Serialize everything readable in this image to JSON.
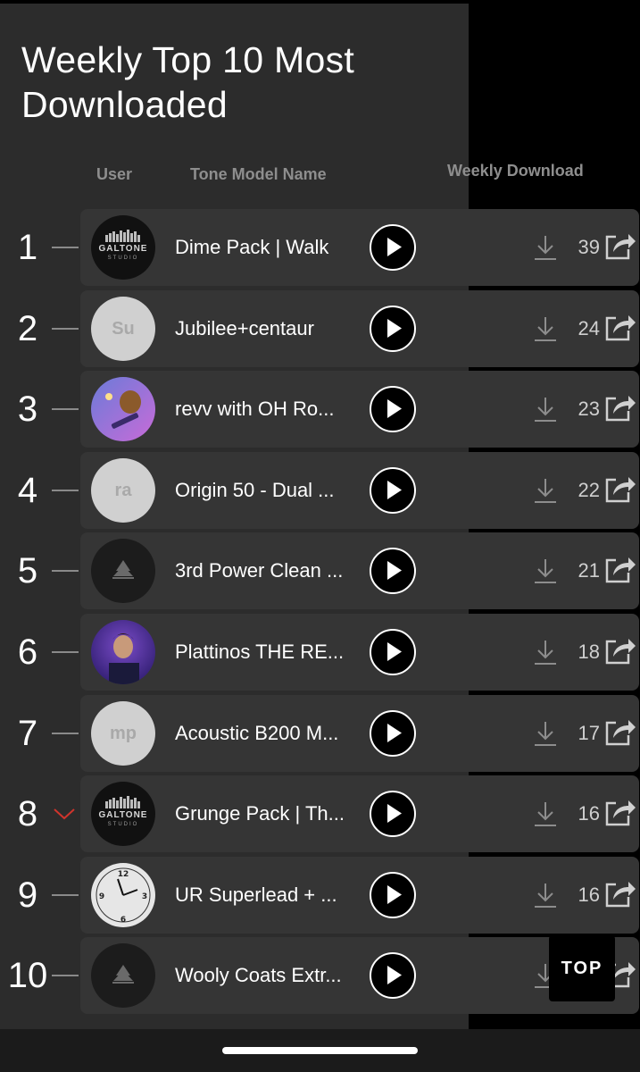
{
  "header": {
    "title": "Weekly Top 10 Most Downloaded"
  },
  "columns": {
    "user": "User",
    "tone_model_name": "Tone Model Name",
    "weekly_download": "Weekly Download"
  },
  "rows": [
    {
      "rank": "1",
      "trend": "same",
      "avatar": "galtone",
      "avatar_text": "GALTONE",
      "avatar_sub": "STUDIO",
      "name": "Dime Pack | Walk",
      "downloads": "39"
    },
    {
      "rank": "2",
      "trend": "same",
      "avatar": "initials",
      "avatar_text": "Su",
      "name": "Jubilee+centaur",
      "downloads": "24"
    },
    {
      "rank": "3",
      "trend": "same",
      "avatar": "cartoon",
      "name": "revv with OH Ro...",
      "downloads": "23"
    },
    {
      "rank": "4",
      "trend": "same",
      "avatar": "initials",
      "avatar_text": "ra",
      "name": "Origin 50 - Dual ...",
      "downloads": "22"
    },
    {
      "rank": "5",
      "trend": "same",
      "avatar": "logo",
      "name": "3rd Power Clean ...",
      "downloads": "21"
    },
    {
      "rank": "6",
      "trend": "same",
      "avatar": "photo",
      "name": "Plattinos THE RE...",
      "downloads": "18"
    },
    {
      "rank": "7",
      "trend": "same",
      "avatar": "initials",
      "avatar_text": "mp",
      "name": "Acoustic B200 M...",
      "downloads": "17"
    },
    {
      "rank": "8",
      "trend": "down",
      "avatar": "galtone",
      "avatar_text": "GALTONE",
      "avatar_sub": "STUDIO",
      "name": "Grunge Pack | Th...",
      "downloads": "16"
    },
    {
      "rank": "9",
      "trend": "same",
      "avatar": "clock",
      "name": "UR Superlead + ...",
      "downloads": "16"
    },
    {
      "rank": "10",
      "trend": "same",
      "avatar": "logo",
      "name": "Wooly Coats Extr...",
      "downloads": ""
    }
  ],
  "top_button": {
    "label": "TOP"
  },
  "colors": {
    "panel": "#2c2c2c",
    "card": "#353535",
    "down_arrow": "#d0342c",
    "muted": "#8e8e8e"
  },
  "icons": {
    "play": "play-icon",
    "download": "download-icon",
    "share": "share-icon",
    "trend_down": "chevron-down-icon",
    "trend_same": "dash-icon"
  }
}
